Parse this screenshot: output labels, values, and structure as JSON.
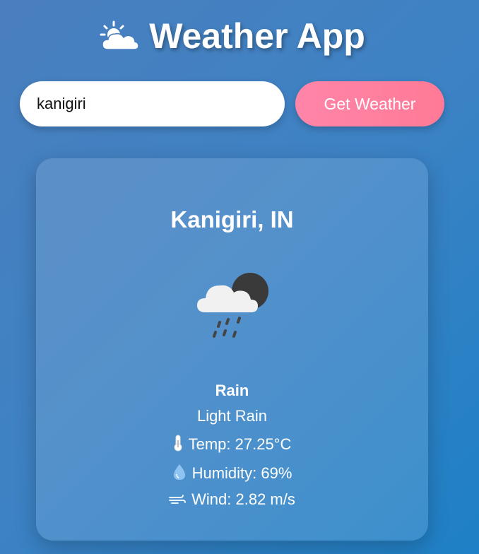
{
  "app": {
    "title": "Weather App",
    "title_icon": "sun-behind-cloud-icon"
  },
  "search": {
    "value": "kanigiri",
    "button_label": "Get Weather"
  },
  "weather": {
    "location": "Kanigiri, IN",
    "icon": "night-cloud-rain-icon",
    "main": "Rain",
    "description": "Light Rain",
    "temp_text": "Temp: 27.25°C",
    "humidity_text": "Humidity: 69%",
    "wind_text": "Wind: 2.82 m/s"
  },
  "colors": {
    "accent_button": "#ff7f9f",
    "card_bg": "rgba(255,255,255,0.12)"
  }
}
